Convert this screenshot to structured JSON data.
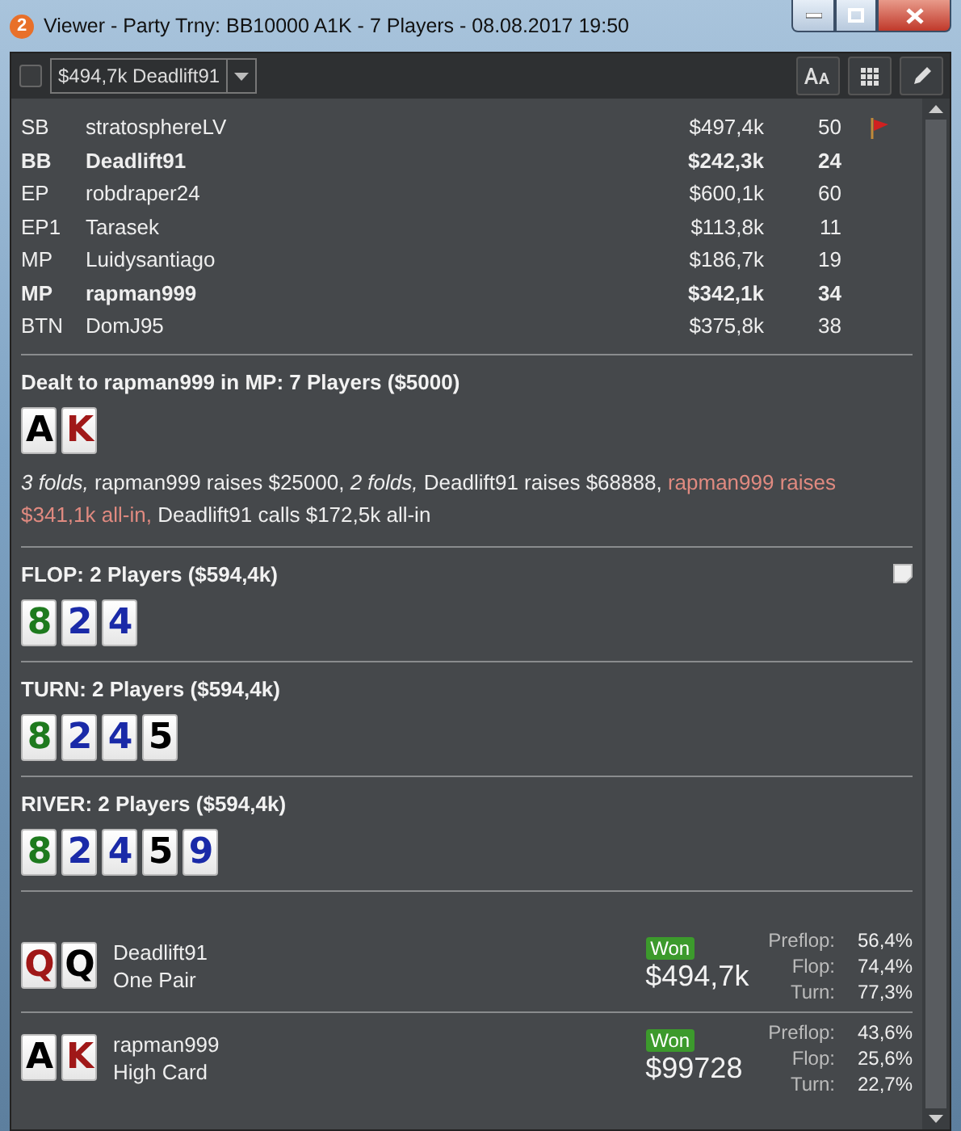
{
  "window": {
    "badge": "2",
    "title": "Viewer - Party Trny: BB10000 A1K - 7 Players - 08.08.2017 19:50"
  },
  "toolbar": {
    "checkbox": {
      "checked": false
    },
    "hand_select": {
      "value": "$494,7k Deadlift91"
    }
  },
  "players": [
    {
      "pos": "SB",
      "name": "stratosphereLV",
      "stack": "$497,4k",
      "bbs": "50",
      "bold": false,
      "note": true
    },
    {
      "pos": "BB",
      "name": "Deadlift91",
      "stack": "$242,3k",
      "bbs": "24",
      "bold": true,
      "note": false
    },
    {
      "pos": "EP",
      "name": "robdraper24",
      "stack": "$600,1k",
      "bbs": "60",
      "bold": false,
      "note": false
    },
    {
      "pos": "EP1",
      "name": "Tarasek",
      "stack": "$113,8k",
      "bbs": "11",
      "bold": false,
      "note": false
    },
    {
      "pos": "MP",
      "name": "Luidysantiago",
      "stack": "$186,7k",
      "bbs": "19",
      "bold": false,
      "note": false
    },
    {
      "pos": "MP",
      "name": "rapman999",
      "stack": "$342,1k",
      "bbs": "34",
      "bold": true,
      "note": false
    },
    {
      "pos": "BTN",
      "name": "DomJ95",
      "stack": "$375,8k",
      "bbs": "38",
      "bold": false,
      "note": false
    }
  ],
  "streets": [
    {
      "title": "Dealt to rapman999 in MP: 7 Players ($5000)",
      "note_icon": false,
      "cards": [
        {
          "rank": "A",
          "color": "#000000"
        },
        {
          "rank": "K",
          "color": "#a01818"
        }
      ],
      "actions": [
        {
          "kind": "italic",
          "text": "3 folds,"
        },
        {
          "kind": "plain",
          "text": "rapman999 raises $25000,"
        },
        {
          "kind": "italic",
          "text": "2 folds,"
        },
        {
          "kind": "plain",
          "text": "Deadlift91 raises $68888,"
        },
        {
          "kind": "highlight",
          "text": "rapman999 raises $341,1k all-in,"
        },
        {
          "kind": "plain",
          "text": "Deadlift91 calls $172,5k all-in"
        }
      ]
    },
    {
      "title": "FLOP: 2 Players ($594,4k)",
      "note_icon": true,
      "cards": [
        {
          "rank": "8",
          "color": "#1e7a1e"
        },
        {
          "rank": "2",
          "color": "#1a2aa8"
        },
        {
          "rank": "4",
          "color": "#1a2aa8"
        }
      ]
    },
    {
      "title": "TURN: 2 Players ($594,4k)",
      "note_icon": false,
      "cards": [
        {
          "rank": "8",
          "color": "#1e7a1e"
        },
        {
          "rank": "2",
          "color": "#1a2aa8"
        },
        {
          "rank": "4",
          "color": "#1a2aa8"
        },
        {
          "rank": "5",
          "color": "#000000"
        }
      ]
    },
    {
      "title": "RIVER: 2 Players ($594,4k)",
      "note_icon": false,
      "cards": [
        {
          "rank": "8",
          "color": "#1e7a1e"
        },
        {
          "rank": "2",
          "color": "#1a2aa8"
        },
        {
          "rank": "4",
          "color": "#1a2aa8"
        },
        {
          "rank": "5",
          "color": "#000000"
        },
        {
          "rank": "9",
          "color": "#1a2aa8"
        }
      ]
    }
  ],
  "results": [
    {
      "cards": [
        {
          "rank": "Q",
          "color": "#a01818"
        },
        {
          "rank": "Q",
          "color": "#000000"
        }
      ],
      "name": "Deadlift91",
      "hand": "One Pair",
      "badge": "Won",
      "amount": "$494,7k",
      "equity": [
        {
          "label": "Preflop:",
          "value": "56,4%"
        },
        {
          "label": "Flop:",
          "value": "74,4%"
        },
        {
          "label": "Turn:",
          "value": "77,3%"
        }
      ]
    },
    {
      "cards": [
        {
          "rank": "A",
          "color": "#000000"
        },
        {
          "rank": "K",
          "color": "#a01818"
        }
      ],
      "name": "rapman999",
      "hand": "High Card",
      "badge": "Won",
      "amount": "$99728",
      "equity": [
        {
          "label": "Preflop:",
          "value": "43,6%"
        },
        {
          "label": "Flop:",
          "value": "25,6%"
        },
        {
          "label": "Turn:",
          "value": "22,7%"
        }
      ]
    }
  ]
}
